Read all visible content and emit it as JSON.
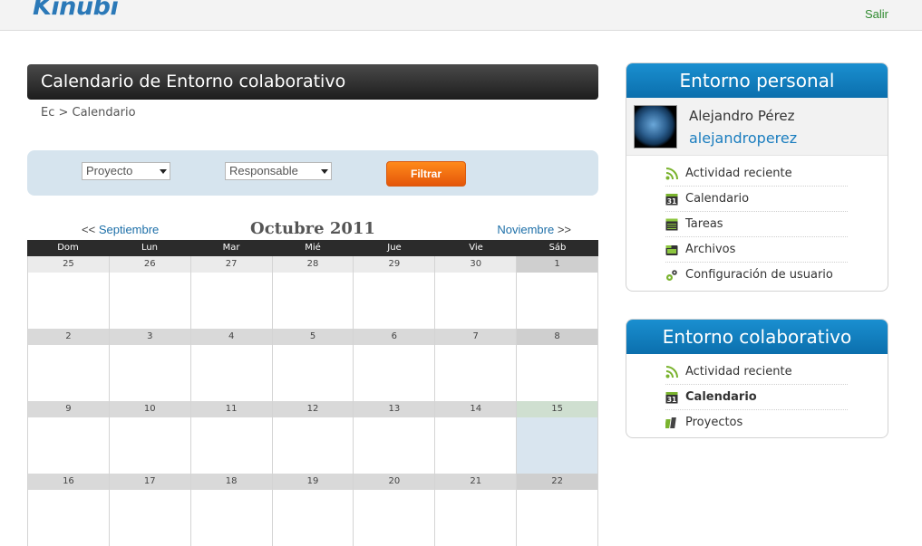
{
  "header": {
    "logo": "Kinubi",
    "logout": "Salir"
  },
  "page": {
    "title": "Calendario de Entorno colaborativo",
    "breadcrumb": "Ec > Calendario"
  },
  "filters": {
    "project": "Proyecto",
    "responsible": "Responsable",
    "filter_button": "Filtrar"
  },
  "calendar": {
    "prev_arrows": "<<",
    "prev_month": "Septiembre",
    "month_title": "Octubre 2011",
    "next_month": "Noviembre",
    "next_arrows": ">>",
    "weekdays": [
      "Dom",
      "Lun",
      "Mar",
      "Mié",
      "Jue",
      "Vie",
      "Sáb"
    ],
    "weeks": [
      [
        "25",
        "26",
        "27",
        "28",
        "29",
        "30",
        "1"
      ],
      [
        "2",
        "3",
        "4",
        "5",
        "6",
        "7",
        "8"
      ],
      [
        "9",
        "10",
        "11",
        "12",
        "13",
        "14",
        "15"
      ],
      [
        "16",
        "17",
        "18",
        "19",
        "20",
        "21",
        "22"
      ]
    ]
  },
  "personal": {
    "title": "Entorno personal",
    "user_name": "Alejandro Pérez",
    "user_login": "alejandroperez",
    "items": [
      {
        "label": "Actividad reciente",
        "icon": "rss-icon"
      },
      {
        "label": "Calendario",
        "icon": "calendar-icon"
      },
      {
        "label": "Tareas",
        "icon": "tasks-icon"
      },
      {
        "label": "Archivos",
        "icon": "files-icon"
      },
      {
        "label": "Configuración de usuario",
        "icon": "gear-icon"
      }
    ]
  },
  "collab": {
    "title": "Entorno colaborativo",
    "items": [
      {
        "label": "Actividad reciente",
        "icon": "rss-icon"
      },
      {
        "label": "Calendario",
        "icon": "calendar-icon"
      },
      {
        "label": "Proyectos",
        "icon": "projects-icon"
      }
    ]
  },
  "colors": {
    "accent_blue": "#0b6fad",
    "filter_orange": "#ff7a10",
    "logout_green": "#2f8a2f"
  }
}
